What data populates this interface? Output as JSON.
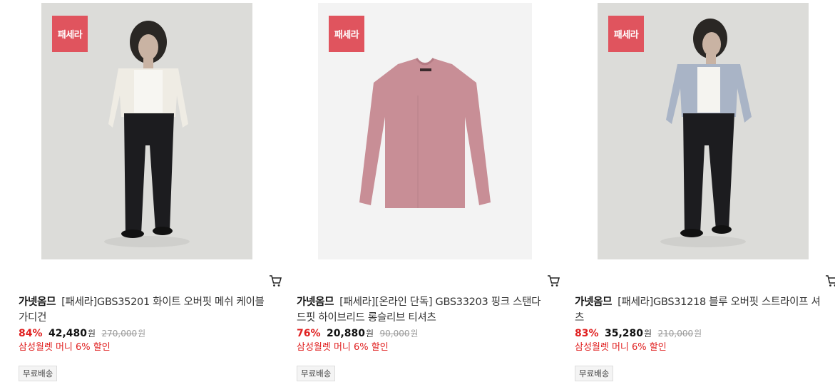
{
  "products": [
    {
      "badge": "패세라",
      "brand": "가넷옴므",
      "name": "[패세라]GBS35201 화이트 오버핏 메쉬 케이블 가디건",
      "discount": "84%",
      "price": "42,480",
      "price_unit": "원",
      "original_price": "270,000",
      "original_unit": "원",
      "promo": "삼성월렛 머니 6% 할인",
      "shipping": "무료배송",
      "image": "model-white-cardigan"
    },
    {
      "badge": "패세라",
      "brand": "가넷옴므",
      "name": "[패세라][온라인 단독] GBS33203 핑크 스탠다드핏 하이브리드 롱슬리브 티셔츠",
      "discount": "76%",
      "price": "20,880",
      "price_unit": "원",
      "original_price": "90,000",
      "original_unit": "원",
      "promo": "삼성월렛 머니 6% 할인",
      "shipping": "무료배송",
      "image": "pink-longsleeve-tshirt"
    },
    {
      "badge": "패세라",
      "brand": "가넷옴므",
      "name": "[패세라]GBS31218 블루 오버핏 스트라이프 셔츠",
      "discount": "83%",
      "price": "35,280",
      "price_unit": "원",
      "original_price": "210,000",
      "original_unit": "원",
      "promo": "삼성월렛 머니 6% 할인",
      "shipping": "무료배송",
      "image": "model-blue-stripe-shirt"
    }
  ],
  "colors": {
    "badge_bg": "#e0545e",
    "discount": "#e02020",
    "promo": "#e02020"
  }
}
